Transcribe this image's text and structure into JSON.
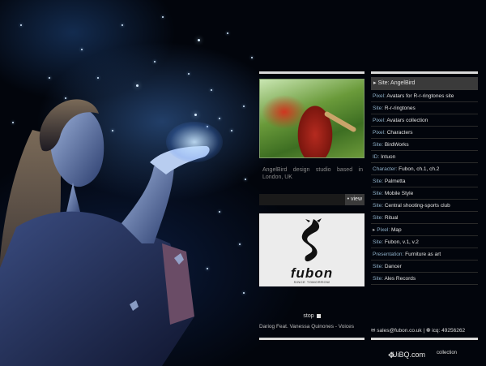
{
  "main": {
    "preview_caption": "AngelBird design studio based in London, UK",
    "view_label": "• view",
    "logo": {
      "word": "fubon",
      "tagline": "SINCE TOMORROW"
    }
  },
  "portfolio": {
    "header": "Site: AngelBird",
    "items": [
      {
        "prefix": "Pixel:",
        "text": "Avatars for R-r-ringtones site"
      },
      {
        "prefix": "Site:",
        "text": "R-r-ringtones"
      },
      {
        "prefix": "Pixel:",
        "text": "Avatars collection"
      },
      {
        "prefix": "Pixel:",
        "text": "Characters"
      },
      {
        "prefix": "Site:",
        "text": "BirdWorks"
      },
      {
        "prefix": "ID:",
        "text": "Intuon"
      },
      {
        "prefix": "Character:",
        "text": "Fubon, ch.1, ch.2"
      },
      {
        "prefix": "Site:",
        "text": "Palmetta"
      },
      {
        "prefix": "Site:",
        "text": "Mobile Style"
      },
      {
        "prefix": "Site:",
        "text": "Central shooting-sports club"
      },
      {
        "prefix": "Site:",
        "text": "Ritual"
      },
      {
        "prefix": "Pixel:",
        "text": "Map"
      },
      {
        "prefix": "Site:",
        "text": "Fubon, v.1, v.2"
      },
      {
        "prefix": "Presentation:",
        "text": "Furniture as art"
      },
      {
        "prefix": "Site:",
        "text": "Dancer"
      },
      {
        "prefix": "Site:",
        "text": "Ales Records"
      }
    ]
  },
  "player": {
    "stop_label": "stop",
    "track": "Dariog Feat. Vanessa Quinones - Voices"
  },
  "contact": {
    "email": "sales@fubon.co.uk",
    "icq": "icq: 49256262"
  },
  "watermark": {
    "top": "collection",
    "main": "UiBQ.com"
  }
}
